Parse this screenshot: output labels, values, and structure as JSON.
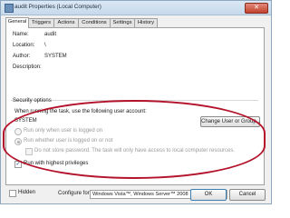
{
  "window": {
    "title": "audit Properties (Local Computer)",
    "close_glyph": "✕"
  },
  "tabs": [
    "General",
    "Triggers",
    "Actions",
    "Conditions",
    "Settings",
    "History"
  ],
  "general": {
    "name_label": "Name:",
    "name_value": "audit",
    "location_label": "Location:",
    "location_value": "\\",
    "author_label": "Author:",
    "author_value": "SYSTEM",
    "description_label": "Description:"
  },
  "security": {
    "heading": "Security options",
    "run_as_label": "When running the task, use the following user account:",
    "account": "SYSTEM",
    "change_button": "Change User or Group...",
    "radio_logged_on": "Run only when user is logged on",
    "radio_whether": "Run whether user is logged on or not",
    "no_store_password": "Do not store password.  The task will only have access to local computer resources.",
    "highest_privileges": "Run with highest privileges",
    "highest_checked": true
  },
  "footer": {
    "hidden_label": "Hidden",
    "configure_label": "Configure for:",
    "configure_value": "Windows Vista™, Windows Server™ 2008",
    "ok": "OK",
    "cancel": "Cancel"
  },
  "colors": {
    "annotation_oval": "#b3122a"
  }
}
